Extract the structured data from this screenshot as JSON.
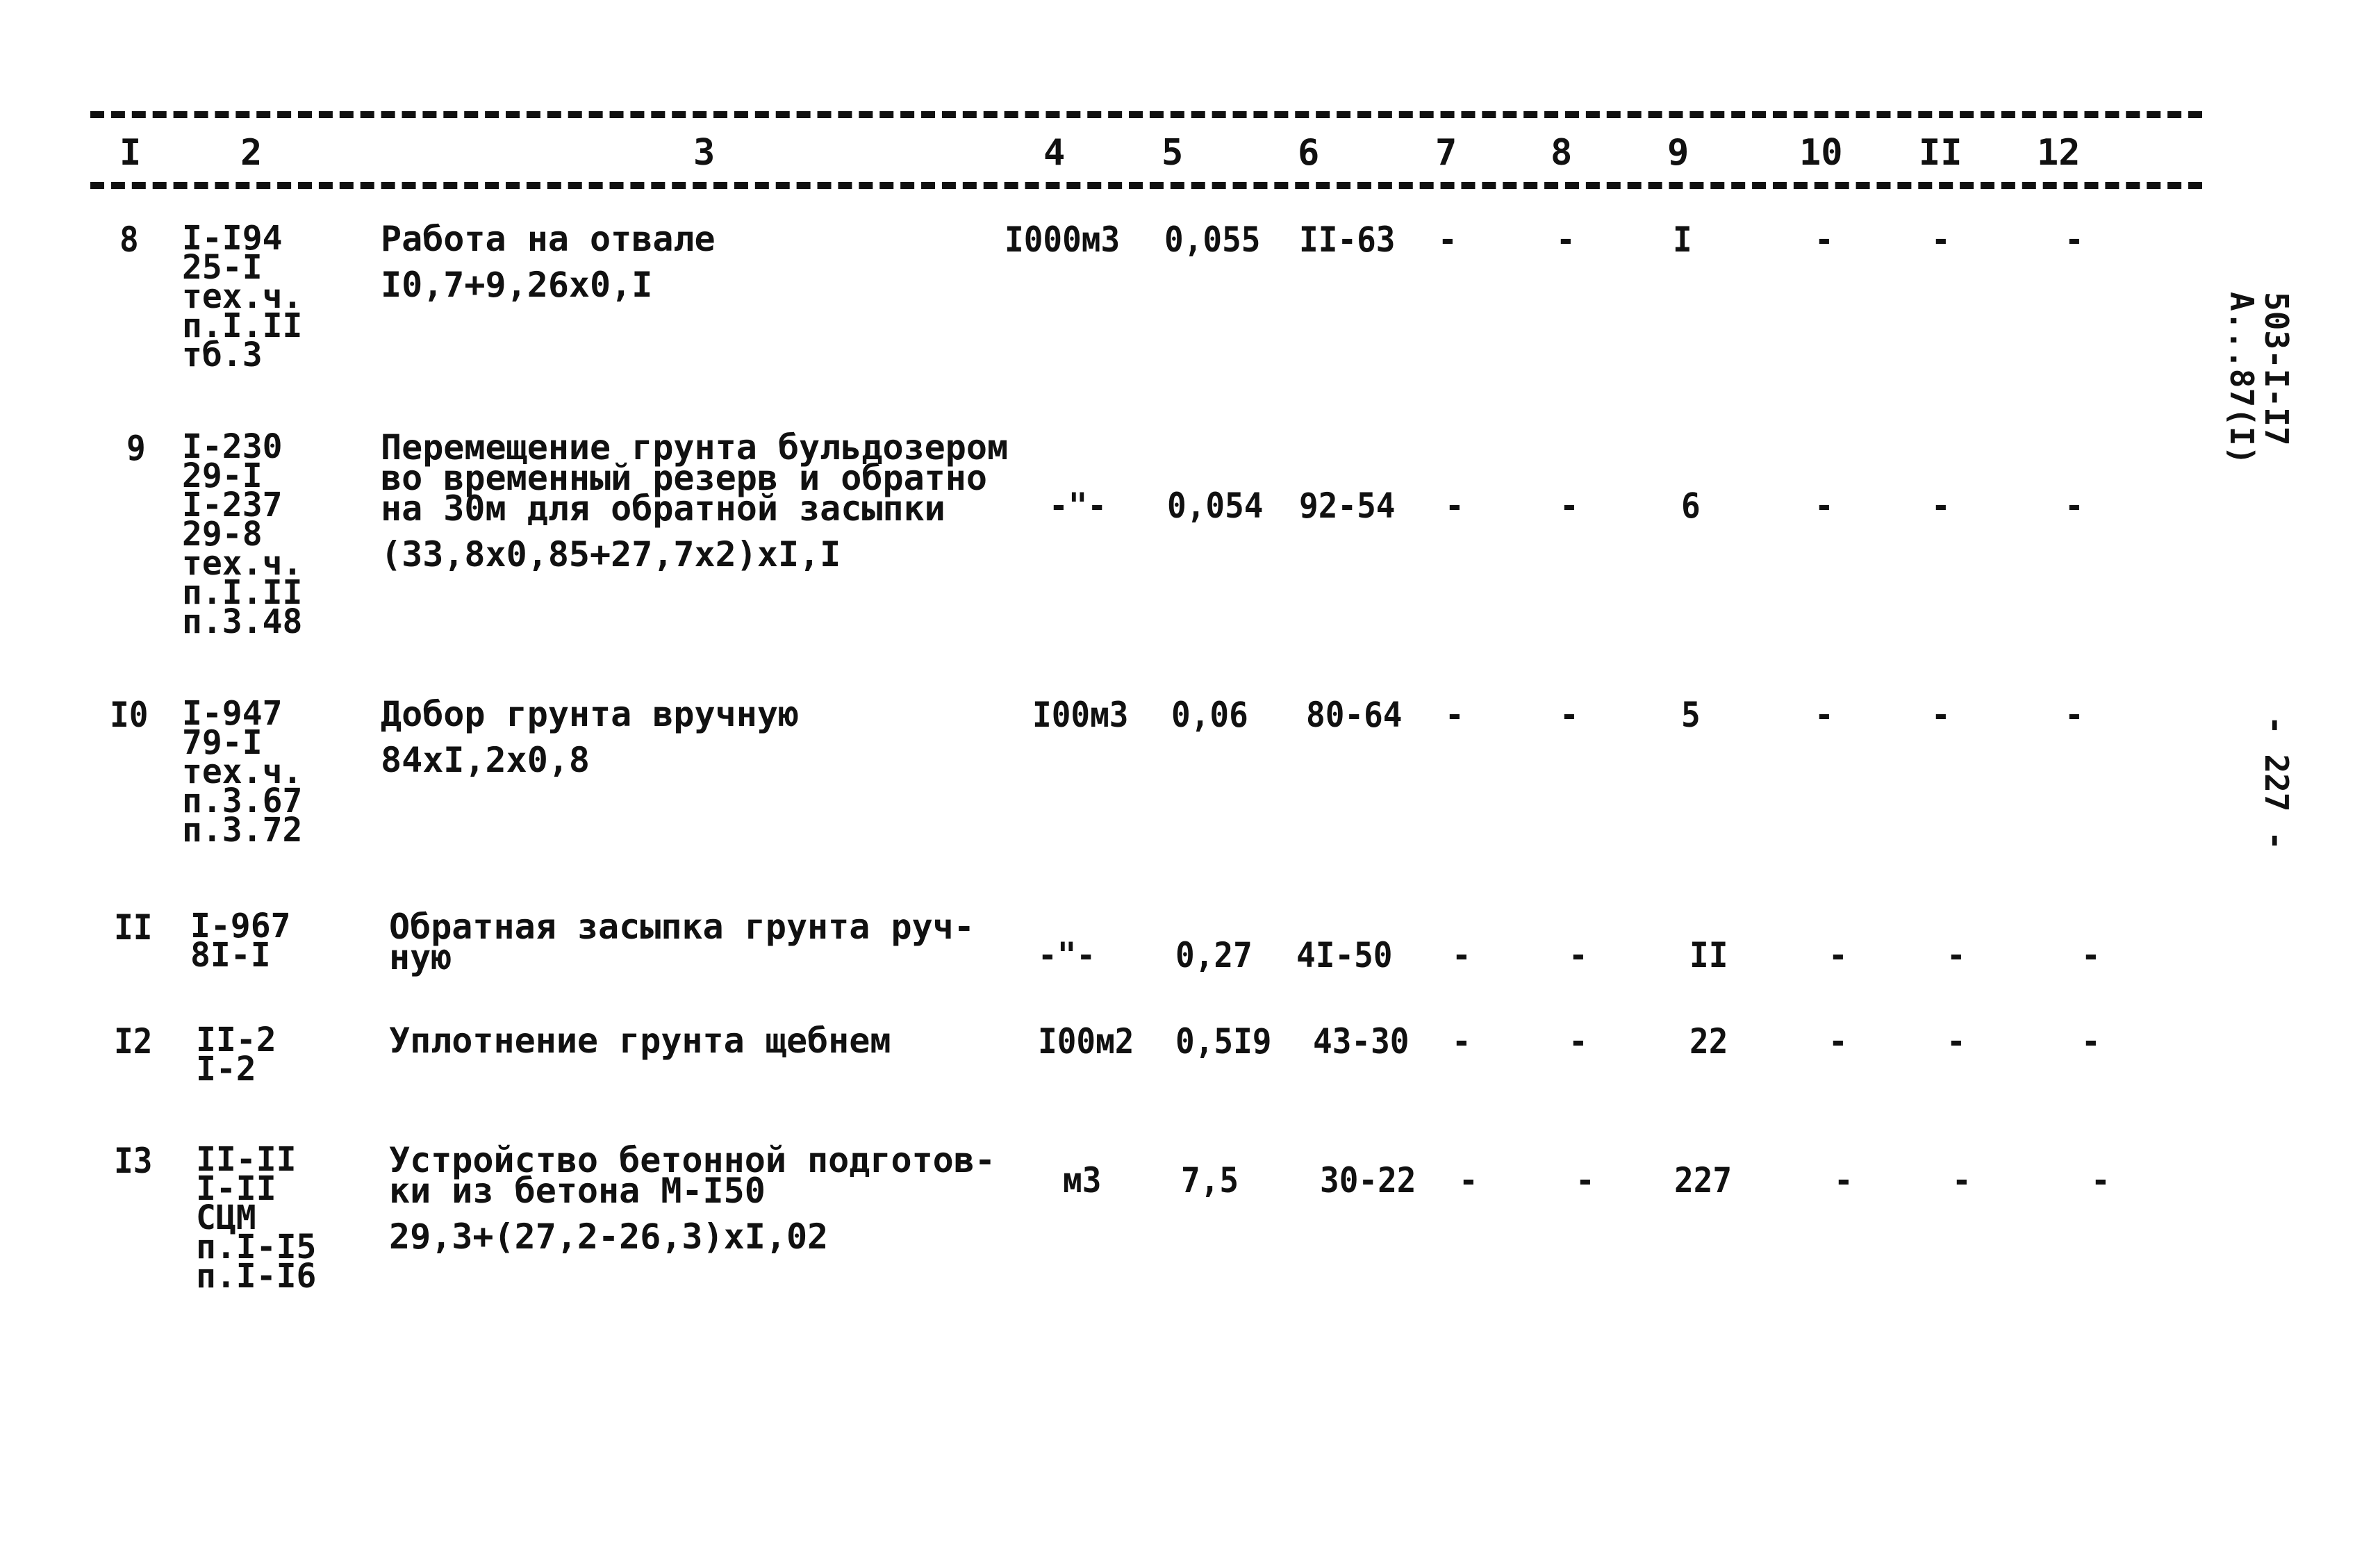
{
  "document": {
    "side_code_line1": "503-I-I7",
    "side_code_line2": "А...87(I)",
    "page_number": "- 227 -"
  },
  "header": {
    "columns": [
      "I",
      "2",
      "3",
      "4",
      "5",
      "6",
      "7",
      "8",
      "9",
      "10",
      "II",
      "12"
    ]
  },
  "rows": [
    {
      "num": "8",
      "refs": [
        "I-I94",
        "25-I",
        "тех.ч.",
        "п.I.II",
        "тб.3"
      ],
      "desc_lines": [
        "Работа на отвале"
      ],
      "formula": "I0,7+9,26x0,I",
      "unit": "I000м3",
      "qty": "0,055",
      "c6": "II-63",
      "c7": "-",
      "c8": "-",
      "c9": "I",
      "c10": "-",
      "c11": "-",
      "c12": "-"
    },
    {
      "num": "9",
      "refs": [
        "I-230",
        "29-I",
        "I-237",
        "29-8",
        "тех.ч.",
        "п.I.II",
        "п.3.48"
      ],
      "desc_lines": [
        "Перемещение грунта бульдозером",
        "во временный резерв и обратно",
        "на 30м для обратной засыпки"
      ],
      "formula": "(33,8x0,85+27,7x2)xI,I",
      "unit": "-\"-",
      "qty": "0,054",
      "c6": "92-54",
      "c7": "-",
      "c8": "-",
      "c9": "6",
      "c10": "-",
      "c11": "-",
      "c12": "-"
    },
    {
      "num": "I0",
      "refs": [
        "I-947",
        "79-I",
        "тех.ч.",
        "п.3.67",
        "п.3.72"
      ],
      "desc_lines": [
        "Добор грунта вручную"
      ],
      "formula": "84xI,2x0,8",
      "unit": "I00м3",
      "qty": "0,06",
      "c6": "80-64",
      "c7": "-",
      "c8": "-",
      "c9": "5",
      "c10": "-",
      "c11": "-",
      "c12": "-"
    },
    {
      "num": "II",
      "refs": [
        "I-967",
        "8I-I"
      ],
      "desc_lines": [
        "Обратная засыпка грунта руч-",
        "ную"
      ],
      "formula": "",
      "unit": "-\"-",
      "qty": "0,27",
      "c6": "4I-50",
      "c7": "-",
      "c8": "-",
      "c9": "II",
      "c10": "-",
      "c11": "-",
      "c12": "-"
    },
    {
      "num": "I2",
      "refs": [
        "II-2",
        "I-2"
      ],
      "desc_lines": [
        "Уплотнение грунта щебнем"
      ],
      "formula": "",
      "unit": "I00м2",
      "qty": "0,5I9",
      "c6": "43-30",
      "c7": "-",
      "c8": "-",
      "c9": "22",
      "c10": "-",
      "c11": "-",
      "c12": "-"
    },
    {
      "num": "I3",
      "refs": [
        "II-II",
        "I-II",
        "СЦМ",
        "п.I-I5",
        "п.I-I6"
      ],
      "desc_lines": [
        "Устройство бетонной подготов-",
        "ки из бетона М-I50"
      ],
      "formula": "29,3+(27,2-26,3)xI,02",
      "unit": "м3",
      "qty": "7,5",
      "c6": "30-22",
      "c7": "-",
      "c8": "-",
      "c9": "227",
      "c10": "-",
      "c11": "-",
      "c12": "-"
    }
  ]
}
